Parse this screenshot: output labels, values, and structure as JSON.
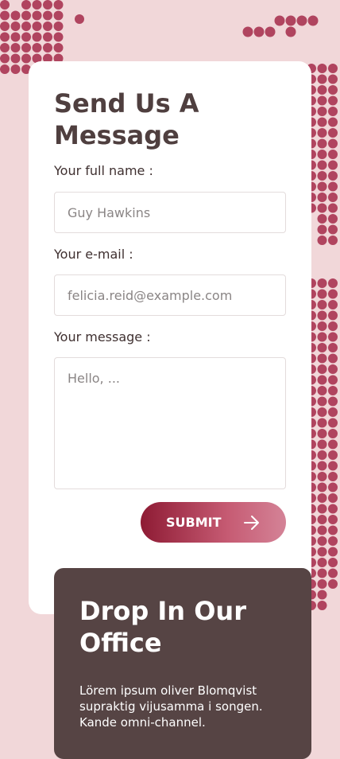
{
  "form": {
    "title": "Send Us A Message",
    "name_label": "Your full name :",
    "name_placeholder": "Guy Hawkins",
    "email_label": "Your e-mail :",
    "email_placeholder": "felicia.reid@example.com",
    "message_label": "Your message :",
    "message_placeholder": "Hello, ...",
    "submit_label": "SUBMIT",
    "submit_icon": "arrow-right-icon"
  },
  "office": {
    "title": "Drop In Our Office",
    "text": "Lörem ipsum oliver Blomqvist supraktig vijusamma i songen. Kande omni-channel."
  },
  "colors": {
    "background": "#f1d7d9",
    "dot": "#b0445f",
    "card": "#ffffff",
    "heading": "#4f3f3f",
    "office_bg": "#564444",
    "accent_dark": "#8e1b34",
    "accent_light": "#d48397"
  }
}
